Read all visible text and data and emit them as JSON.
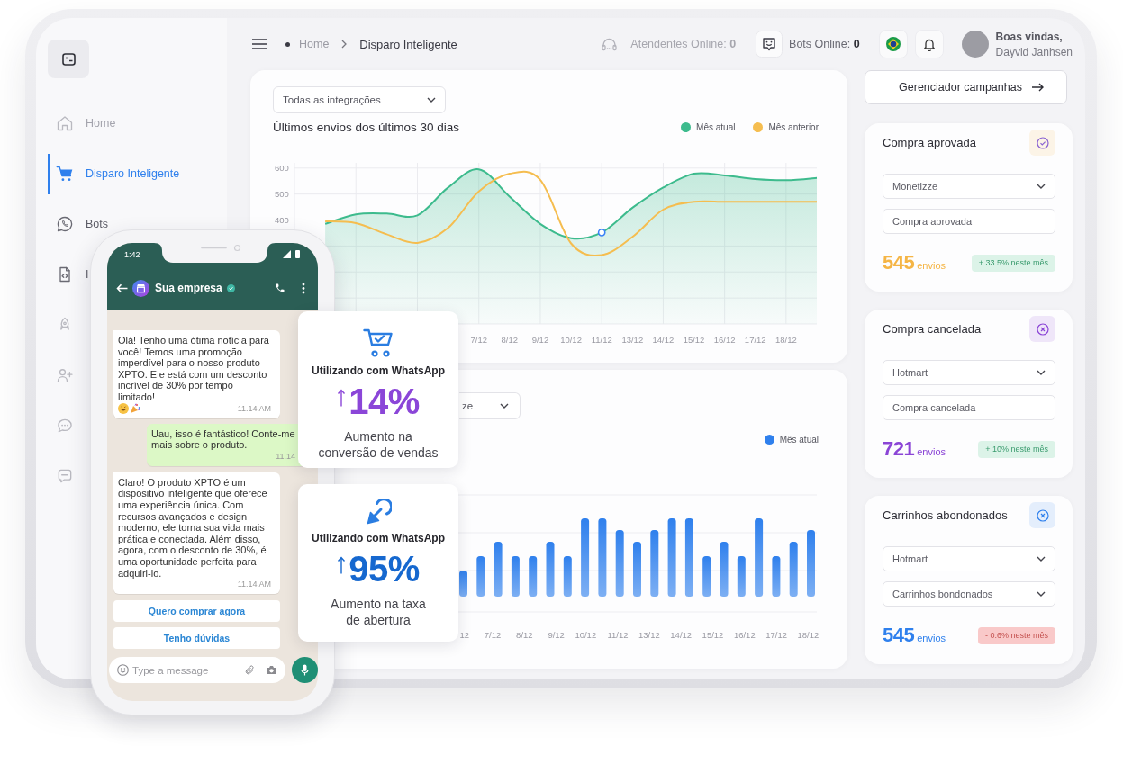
{
  "sidebar": {
    "items": [
      {
        "kind": "home",
        "label": "Home",
        "selected": false,
        "disabled": true
      },
      {
        "kind": "cart",
        "label": "Disparo Inteligente",
        "selected": true,
        "disabled": false
      },
      {
        "kind": "whatsapp",
        "label": "Bots",
        "selected": false,
        "disabled": false
      },
      {
        "kind": "code",
        "label": "I",
        "selected": false,
        "disabled": false
      },
      {
        "kind": "rocket",
        "selected": false,
        "disabled": true
      },
      {
        "kind": "user-plus",
        "selected": false,
        "disabled": true
      },
      {
        "kind": "chat",
        "selected": false,
        "disabled": true
      },
      {
        "kind": "sms",
        "selected": false,
        "disabled": true
      }
    ]
  },
  "topbar": {
    "breadcrumb": [
      {
        "label": "Home",
        "current": false
      },
      {
        "label": "Disparo Inteligente",
        "current": true
      }
    ],
    "status": [
      {
        "kind": "agents",
        "label": "Atendentes Online:",
        "count": "0",
        "disabled": true
      },
      {
        "kind": "bots",
        "label": "Bots Online:",
        "count": "0",
        "disabled": false
      }
    ],
    "user": {
      "greeting": "Boas vindas,",
      "name": "Dayvid Janhsen"
    }
  },
  "sends_chart": {
    "filter": "Todas as integrações",
    "chart_data": {
      "type": "line",
      "title": "Últimos envios dos últimos 30 dias",
      "categories": [
        null,
        null,
        null,
        null,
        null,
        null,
        "7/12",
        "8/12",
        "9/12",
        "10/12",
        "11/12",
        "13/12",
        "14/12",
        "15/12",
        "16/12",
        "17/12",
        "18/12",
        null
      ],
      "series": [
        {
          "name": "Mês atual",
          "color": "#3dbb8d",
          "type": "area",
          "values": [
            null,
            385,
            422,
            425,
            418,
            525,
            595,
            490,
            385,
            330,
            352,
            447,
            525,
            578,
            572,
            558,
            553,
            562
          ]
        },
        {
          "name": "Mês anterior",
          "color": "#f5bd4f",
          "type": "line",
          "values": [
            null,
            395,
            388,
            345,
            312,
            370,
            510,
            578,
            555,
            310,
            265,
            335,
            440,
            470,
            470,
            470,
            470,
            470
          ]
        }
      ],
      "ylim": [
        0,
        620
      ],
      "yticks": [
        400,
        500,
        600
      ],
      "grid": true,
      "annotations": [
        {
          "x": "11/12"
        }
      ]
    }
  },
  "bars_chart": {
    "filter": "ze",
    "legend": [
      {
        "label": "Mês atual",
        "color": "#2f80ed"
      }
    ],
    "x_labels": [
      "12",
      "7/12",
      "8/12",
      "9/12",
      "10/12",
      "11/12",
      "13/12",
      "14/12",
      "15/12",
      "16/12",
      "17/12",
      "18/12"
    ]
  },
  "campaign_button": {
    "label": "Gerenciador campanhas"
  },
  "trigger_cards": [
    {
      "title": "Compra aprovada",
      "kind": "check",
      "color": "#f5b545",
      "fields": [
        {
          "kind": "select",
          "value": "Monetizze"
        },
        {
          "kind": "input",
          "value": "Compra aprovada"
        }
      ],
      "count": "545",
      "unit": "envios",
      "change": "+ 33.5% neste mês",
      "positive": true
    },
    {
      "title": "Compra cancelada",
      "kind": "cancel",
      "color": "#8b45d6",
      "fields": [
        {
          "kind": "select",
          "value": "Hotmart"
        },
        {
          "kind": "input",
          "value": "Compra cancelada"
        }
      ],
      "count": "721",
      "unit": "envios",
      "change": "+ 10% neste mês",
      "positive": true
    },
    {
      "title": "Carrinhos abondonados",
      "kind": "cancel",
      "color": "#2f80ed",
      "fields": [
        {
          "kind": "select",
          "value": "Hotmart"
        },
        {
          "kind": "select",
          "value": "Carrinhos bondonados"
        }
      ],
      "count": "545",
      "unit": "envios",
      "change": "- 0.6% neste mês",
      "positive": false
    }
  ],
  "phone": {
    "time": "1:42",
    "contact": {
      "name": "Sua empresa",
      "verified": true
    },
    "messages": [
      {
        "kind": "received",
        "text": "Olá! Tenho uma ótima notícia para você! Temos uma promoção imperdível para o nosso produto XPTO. Ele está com um desconto incrível de 30% por tempo limitado!",
        "emoji": [
          {
            "kind": "grin"
          },
          {
            "kind": "party"
          }
        ],
        "time": "11.14 AM"
      },
      {
        "kind": "sent",
        "text": "Uau, isso é fantástico! Conte-me mais sobre o produto.",
        "time": "11.14"
      },
      {
        "kind": "received",
        "text": "Claro! O produto XPTO é um dispositivo inteligente que oferece uma experiência única. Com recursos avançados e design moderno, ele torna sua vida mais prática e conectada. Além disso, agora, com o desconto de 30%, é uma oportunidade perfeita para adquiri-lo.",
        "time": "11.14 AM"
      }
    ],
    "quick_replies": [
      "Quero comprar agora",
      "Tenho dúvidas"
    ],
    "composer": {
      "placeholder": "Type a message"
    }
  },
  "stat_cards": [
    {
      "kind": "cart",
      "caption": "Utilizando com WhatsApp",
      "value": "14%",
      "color": "#8b46d8",
      "description": "Aumento na\nconversão de vendas"
    },
    {
      "kind": "click",
      "caption": "Utilizando com WhatsApp",
      "value": "95%",
      "color": "#1668cf",
      "description": "Aumento na taxa\nde abertura"
    }
  ]
}
